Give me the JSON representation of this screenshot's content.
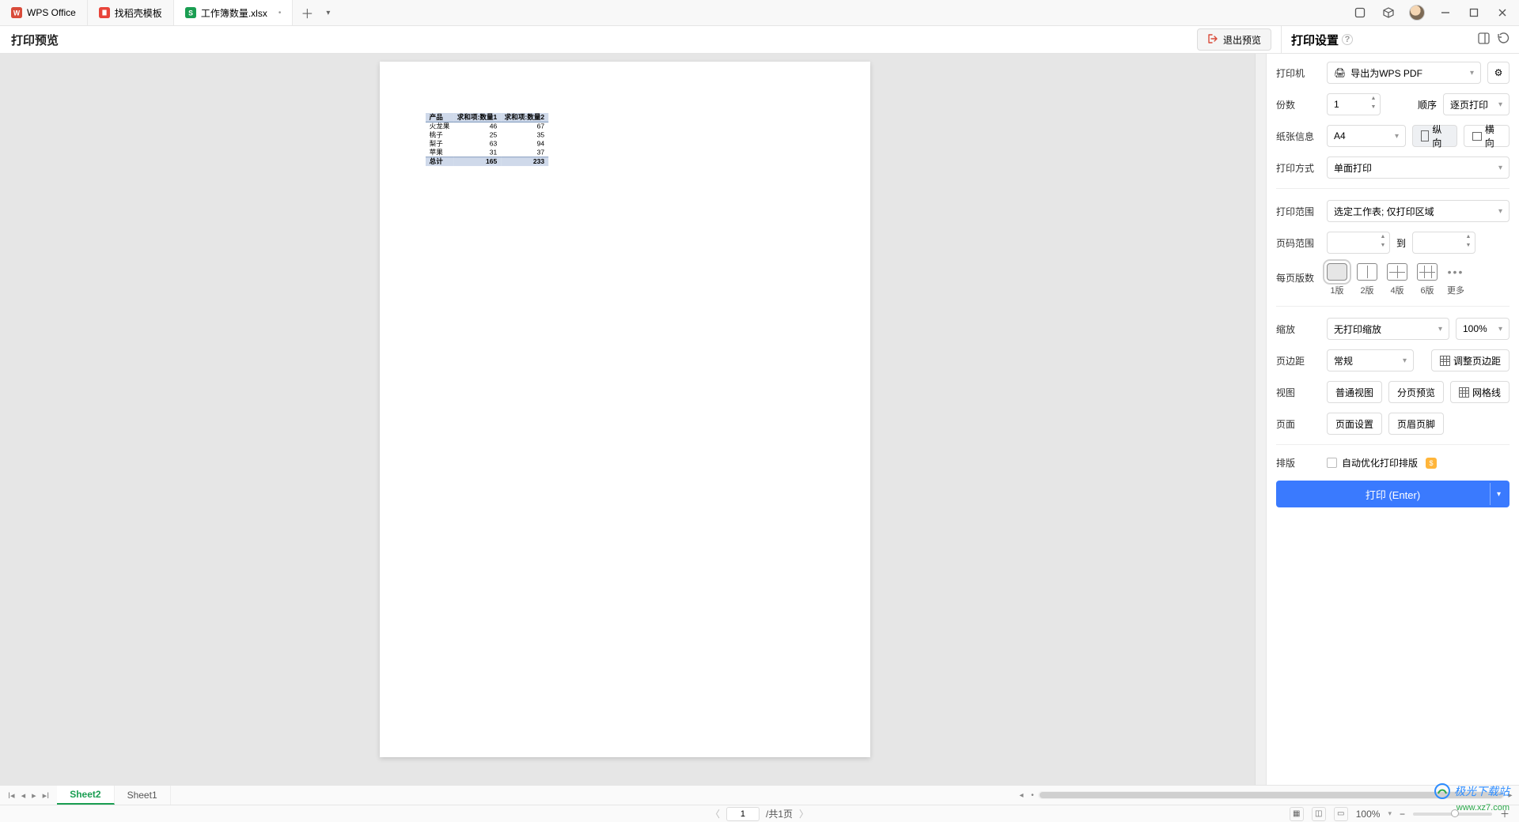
{
  "tabs": {
    "t0": {
      "label": "WPS Office"
    },
    "t1": {
      "label": "找稻壳模板"
    },
    "t2": {
      "label": "工作簿数量.xlsx"
    }
  },
  "header": {
    "title": "打印预览",
    "exit": "退出预览",
    "settingsTitle": "打印设置"
  },
  "table": {
    "h0": "产品",
    "h1": "求和项:数量1",
    "h2": "求和项:数量2",
    "rows": [
      {
        "c0": "火龙果",
        "c1": "46",
        "c2": "67"
      },
      {
        "c0": "桃子",
        "c1": "25",
        "c2": "35"
      },
      {
        "c0": "梨子",
        "c1": "63",
        "c2": "94"
      },
      {
        "c0": "苹果",
        "c1": "31",
        "c2": "37"
      }
    ],
    "total": {
      "c0": "总计",
      "c1": "165",
      "c2": "233"
    }
  },
  "panel": {
    "printerLbl": "打印机",
    "printer": "导出为WPS PDF",
    "copiesLbl": "份数",
    "copies": "1",
    "orderLbl": "顺序",
    "order": "逐页打印",
    "paperLbl": "纸张信息",
    "paper": "A4",
    "portrait": "纵向",
    "landscape": "横向",
    "modeLbl": "打印方式",
    "mode": "单面打印",
    "rangeLbl": "打印范围",
    "range": "选定工作表; 仅打印区域",
    "pageRangeLbl": "页码范围",
    "toLbl": "到",
    "perPageLbl": "每页版数",
    "p1": "1版",
    "p2": "2版",
    "p4": "4版",
    "p6": "6版",
    "pMore": "更多",
    "scaleLbl": "缩放",
    "scale": "无打印缩放",
    "scalePct": "100%",
    "marginLbl": "页边距",
    "margin": "常规",
    "adjustMargin": "调整页边距",
    "viewLbl": "视图",
    "viewNormal": "普通视图",
    "viewBreak": "分页预览",
    "gridlines": "网格线",
    "pageLbl": "页面",
    "pageSetup": "页面设置",
    "headerFooter": "页眉页脚",
    "layoutLbl": "排版",
    "autoOpt": "自动优化打印排版",
    "printBtn": "打印 (Enter)"
  },
  "sheets": {
    "s0": "Sheet2",
    "s1": "Sheet1"
  },
  "status": {
    "pageVal": "1",
    "pageTotal": "/共1页",
    "zoom": "100%"
  },
  "watermark": {
    "name": "极光下载站",
    "url": "www.xz7.com"
  }
}
